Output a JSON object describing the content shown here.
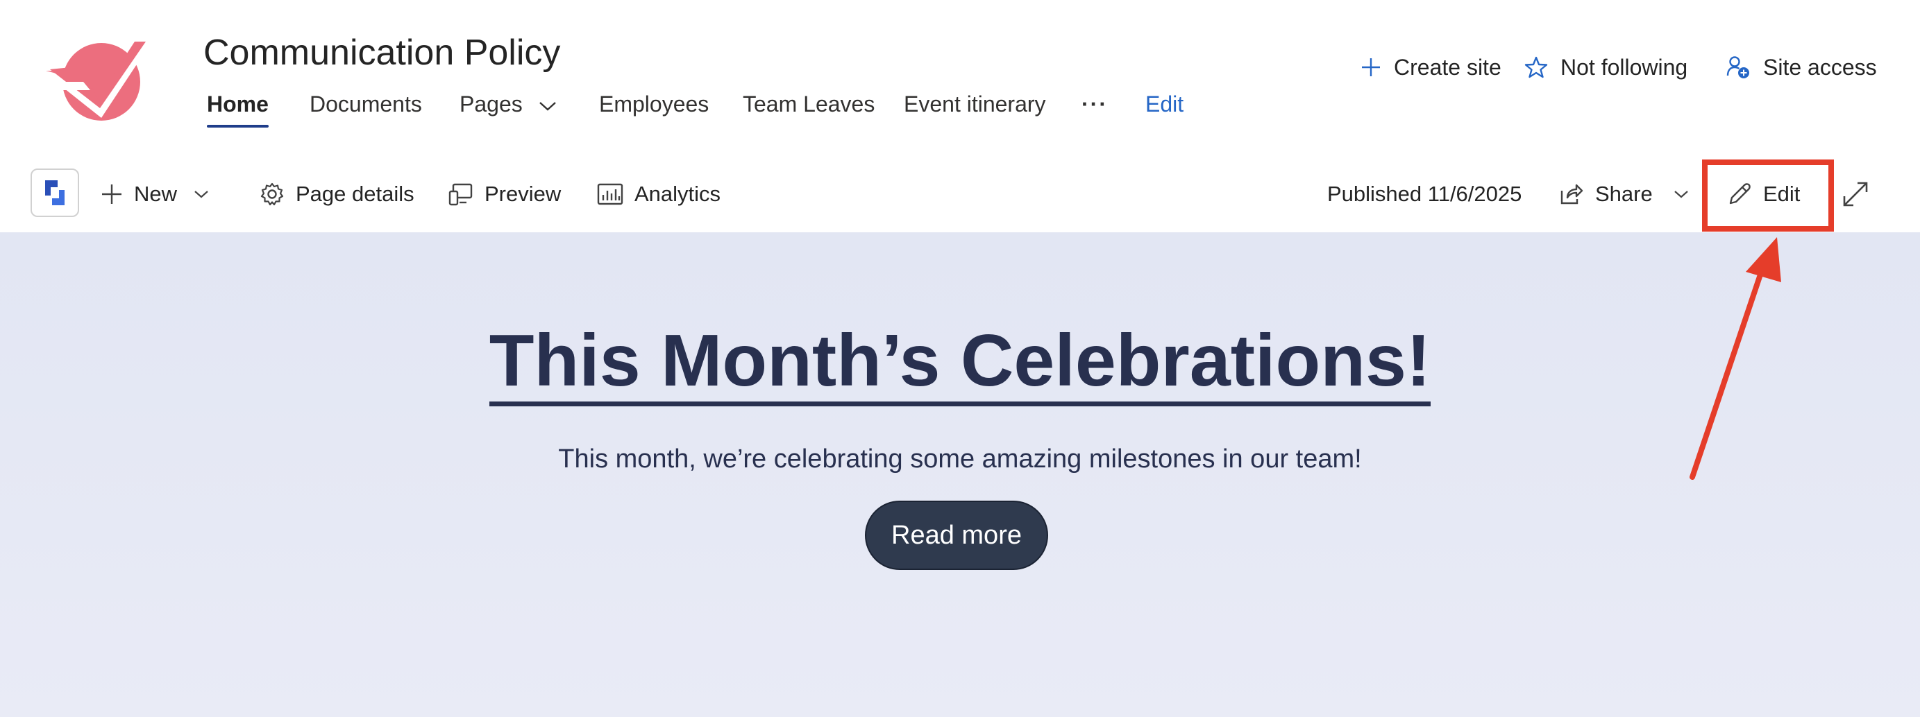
{
  "site": {
    "title": "Communication Policy",
    "nav": [
      {
        "label": "Home",
        "active": true
      },
      {
        "label": "Documents"
      },
      {
        "label": "Pages",
        "has_dropdown": true
      },
      {
        "label": "Employees"
      },
      {
        "label": "Team Leaves"
      },
      {
        "label": "Event itinerary"
      },
      {
        "label": "···"
      },
      {
        "label": "Edit"
      }
    ],
    "actions": {
      "create_site": "Create site",
      "not_following": "Not following",
      "site_access": "Site access"
    }
  },
  "commandbar": {
    "new": "New",
    "page_details": "Page details",
    "preview": "Preview",
    "analytics": "Analytics",
    "published": "Published 11/6/2025",
    "share": "Share",
    "edit": "Edit"
  },
  "hero": {
    "title": "This Month’s Celebrations!",
    "subtitle": "This month, we’re celebrating some amazing milestones in our team!",
    "button": "Read more"
  },
  "colors": {
    "accent": "#1f3d8a",
    "link": "#2566c6",
    "logo": "#ec6e7e",
    "hero_bg": "#e2e6f3",
    "hero_text": "#28304f",
    "button_bg": "#2f3a4e",
    "annotation": "#e53d2a"
  },
  "icons": {
    "logo": "checkmark-logo",
    "create_site": "plus-icon",
    "not_following": "star-icon",
    "site_access": "people-settings-icon",
    "app_tile": "app-launcher-icon",
    "new": "plus-icon",
    "page_details": "gear-icon",
    "preview": "devices-icon",
    "analytics": "bar-chart-icon",
    "share": "share-icon",
    "edit": "pencil-icon",
    "expand": "expand-icon"
  }
}
